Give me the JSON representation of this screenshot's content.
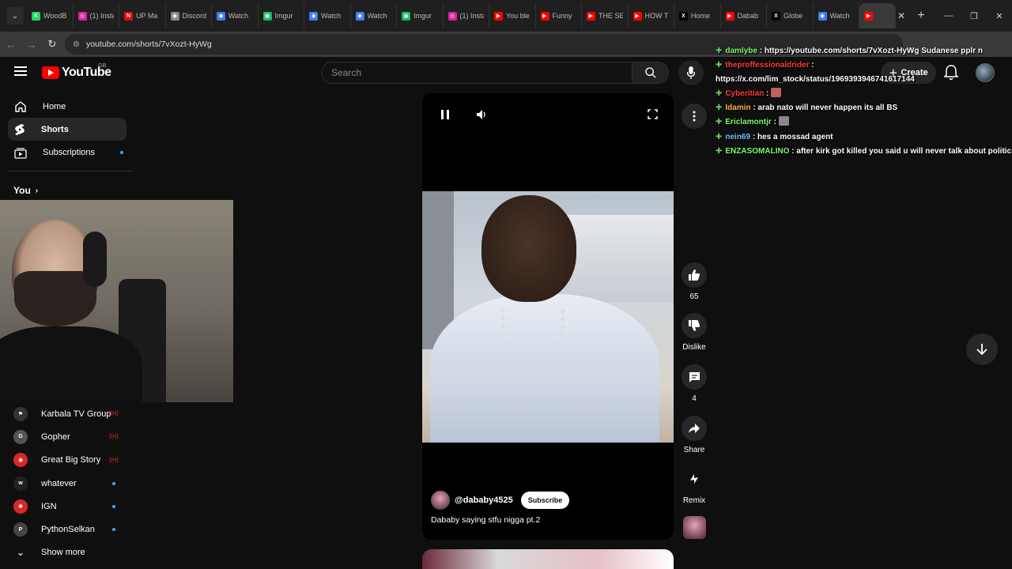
{
  "browser": {
    "tabs": [
      {
        "label": "WoodB",
        "color": "#1ed760",
        "glyph": "K"
      },
      {
        "label": "(1) Insta",
        "color": "#d6249f",
        "glyph": "◎"
      },
      {
        "label": "UP Ma",
        "color": "#e50914",
        "glyph": "N"
      },
      {
        "label": "Discord",
        "color": "#888888",
        "glyph": "◉"
      },
      {
        "label": "Watch",
        "color": "#3d7cf0",
        "glyph": "◉"
      },
      {
        "label": "Imgur",
        "color": "#1bb76e",
        "glyph": "▣"
      },
      {
        "label": "Watch",
        "color": "#3d7cf0",
        "glyph": "◉"
      },
      {
        "label": "Watch",
        "color": "#3d7cf0",
        "glyph": "◉"
      },
      {
        "label": "Imgur",
        "color": "#1bb76e",
        "glyph": "▣"
      },
      {
        "label": "(1) Insta",
        "color": "#d6249f",
        "glyph": "◎"
      },
      {
        "label": "You ble",
        "color": "#ff0000",
        "glyph": "▶"
      },
      {
        "label": "Funny",
        "color": "#ff0000",
        "glyph": "▶"
      },
      {
        "label": "THE SE",
        "color": "#ff0000",
        "glyph": "▶"
      },
      {
        "label": "HOW T",
        "color": "#ff0000",
        "glyph": "▶"
      },
      {
        "label": "Home",
        "color": "#000000",
        "glyph": "X"
      },
      {
        "label": "Dabab",
        "color": "#ff0000",
        "glyph": "▶"
      },
      {
        "label": "Globe",
        "color": "#000000",
        "glyph": "X"
      },
      {
        "label": "Watch",
        "color": "#3d7cf0",
        "glyph": "◉"
      }
    ],
    "active_tab_color": "#ff0000",
    "url": "youtube.com/shorts/7vXozt-HyWg"
  },
  "header": {
    "logo_text": "YouTube",
    "region": "GB",
    "search_placeholder": "Search",
    "create_label": "Create"
  },
  "sidebar": {
    "items": [
      {
        "label": "Home",
        "icon": "home-icon",
        "active": false,
        "dot": false
      },
      {
        "label": "Shorts",
        "icon": "shorts-icon",
        "active": true,
        "dot": false
      },
      {
        "label": "Subscriptions",
        "icon": "subscriptions-icon",
        "active": false,
        "dot": true
      }
    ],
    "you_label": "You",
    "subscriptions": [
      {
        "name": "Karbala TV Group",
        "status": "live",
        "color": "#333333",
        "glyph": "⚑"
      },
      {
        "name": "Gopher",
        "status": "live",
        "color": "#555555",
        "glyph": "G"
      },
      {
        "name": "Great Big Story",
        "status": "live",
        "color": "#d62828",
        "glyph": "◉"
      },
      {
        "name": "whatever",
        "status": "new",
        "color": "#222222",
        "glyph": "w"
      },
      {
        "name": "IGN",
        "status": "new",
        "color": "#d62828",
        "glyph": "✱"
      },
      {
        "name": "PythonSelkan",
        "status": "new",
        "color": "#444444",
        "glyph": "P"
      }
    ],
    "show_more": "Show more"
  },
  "video": {
    "channel_handle": "@dababy4525",
    "subscribe_label": "Subscribe",
    "title": "Dababy saying stfu nigga pt.2"
  },
  "actions": {
    "like_count": "65",
    "dislike_label": "Dislike",
    "comment_count": "4",
    "share_label": "Share",
    "remix_label": "Remix"
  },
  "chat": [
    {
      "user": "damlybe",
      "color": "#7cfc6c",
      "text": "https://youtube.com/shorts/7vXozt-HyWg Sudanese pplr n",
      "emote": false
    },
    {
      "user": "theproffessionaldrider",
      "color": "#ff3b3b",
      "text": "",
      "emote": false
    },
    {
      "user": "",
      "color": "#ffffff",
      "text": "https://x.com/lim_stock/status/1969393946741617144",
      "emote": false
    },
    {
      "user": "Cyberitian",
      "color": "#ff3b3b",
      "text": "",
      "emote": true
    },
    {
      "user": "Idamin",
      "color": "#ffb347",
      "text": "arab nato will never happen its all BS",
      "emote": false
    },
    {
      "user": "Ericlamontjr",
      "color": "#7cfc6c",
      "text": "",
      "emote": true
    },
    {
      "user": "nein69",
      "color": "#6fc3ff",
      "text": "hes a mossad agent",
      "emote": false
    },
    {
      "user": "ENZASOMALINO",
      "color": "#7cfc6c",
      "text": "after kirk got killed you said u will never talk about politics",
      "emote": false
    }
  ]
}
